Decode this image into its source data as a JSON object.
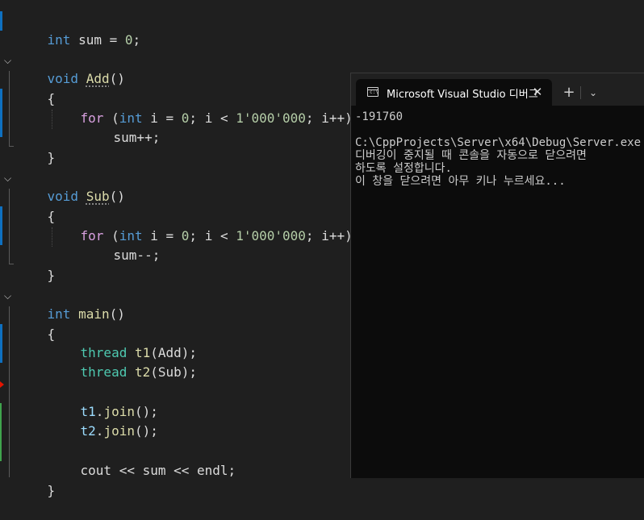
{
  "editor": {
    "lines": [
      [
        "int",
        " sum = ",
        "0",
        ";"
      ],
      [
        "void",
        " ",
        "Add",
        "()"
      ],
      [
        "{"
      ],
      [
        "for",
        " (",
        "int",
        " i = ",
        "0",
        "; i < ",
        "1'000'000",
        "; i++)"
      ],
      [
        "sum++;"
      ],
      [
        "}"
      ],
      [
        "void",
        " ",
        "Sub",
        "()"
      ],
      [
        "{"
      ],
      [
        "for",
        " (",
        "int",
        " i = ",
        "0",
        "; i < ",
        "1'000'000",
        "; i++)"
      ],
      [
        "sum--;"
      ],
      [
        "}"
      ],
      [
        "int",
        " ",
        "main",
        "()"
      ],
      [
        "{"
      ],
      [
        "thread",
        " ",
        "t1",
        "(Add);"
      ],
      [
        "thread",
        " ",
        "t2",
        "(Sub);"
      ],
      [
        "t1",
        ".",
        "join",
        "();"
      ],
      [
        "t2",
        ".",
        "join",
        "();"
      ],
      [
        "cout << sum << endl;"
      ],
      [
        "}"
      ]
    ],
    "fold_icon": "chevron-down-icon"
  },
  "console": {
    "tab_title": "Microsoft Visual Studio 디버그",
    "tab_icon": "terminal-icon",
    "close_label": "✕",
    "new_tab_label": "+",
    "dropdown_label": "⌄",
    "output": [
      "-191760",
      "",
      "C:\\CppProjects\\Server\\x64\\Debug\\Server.exe",
      "디버깅이 중지될 때 콘솔을 자동으로 닫으려면",
      "하도록 설정합니다.",
      "이 창을 닫으려면 아무 키나 누르세요..."
    ]
  },
  "colors": {
    "editor_bg": "#1f1f1f",
    "keyword": "#569cd6",
    "control_keyword": "#d8a0df",
    "type": "#4ec9b0",
    "function": "#dcdcaa",
    "number": "#b5cea8",
    "variable": "#9cdcfe",
    "console_bg": "#0c0c0c"
  }
}
